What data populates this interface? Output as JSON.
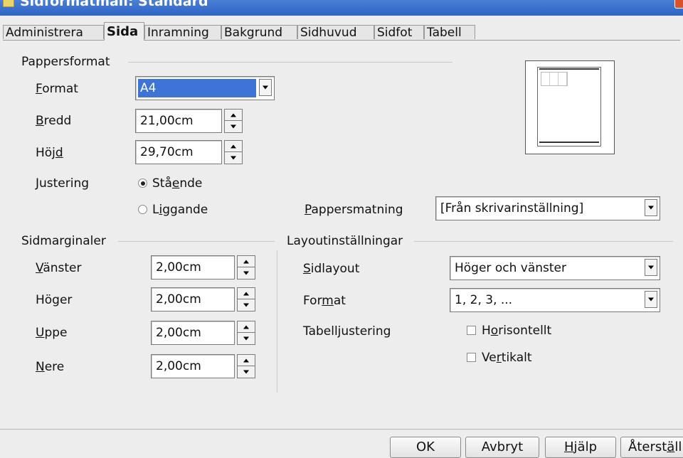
{
  "window": {
    "title": "Sidformatmall: Standard"
  },
  "tabs": [
    {
      "label": "Administrera"
    },
    {
      "label": "Sida"
    },
    {
      "label": "Inramning"
    },
    {
      "label": "Bakgrund"
    },
    {
      "label": "Sidhuvud"
    },
    {
      "label": "Sidfot"
    },
    {
      "label": "Tabell"
    }
  ],
  "paper_format": {
    "title": "Pappersformat",
    "format": {
      "key": "F",
      "rest": "ormat",
      "value": "A4"
    },
    "width": {
      "key": "B",
      "rest": "redd",
      "value": "21,00cm"
    },
    "height": {
      "pre": "Höj",
      "key": "d",
      "value": "29,70cm"
    },
    "orientation": {
      "label": "Justering",
      "portrait": {
        "pre": "Stå",
        "key": "e",
        "post": "nde",
        "checked": true
      },
      "landscape": {
        "pre": "L",
        "key": "i",
        "post": "ggande",
        "checked": false
      }
    },
    "paper_tray": {
      "key": "P",
      "rest": "appersmatning",
      "value": "[Från skrivarinställning]"
    }
  },
  "margins": {
    "title": "Sidmarginaler",
    "left": {
      "key": "V",
      "rest": "änster",
      "value": "2,00cm"
    },
    "right": {
      "label": "Höger",
      "value": "2,00cm"
    },
    "top": {
      "key": "U",
      "rest": "ppe",
      "value": "2,00cm"
    },
    "bottom": {
      "key": "N",
      "rest": "ere",
      "value": "2,00cm"
    }
  },
  "layout": {
    "title": "Layoutinställningar",
    "page_layout": {
      "key": "S",
      "rest": "idlayout",
      "value": "Höger och vänster"
    },
    "format": {
      "pre": "For",
      "key": "m",
      "post": "at",
      "value": "1, 2, 3, ..."
    },
    "table_alignment": {
      "label": "Tabelljustering",
      "horizontal": {
        "pre": "H",
        "key": "o",
        "post": "risontellt",
        "checked": false
      },
      "vertical": {
        "pre": "Ve",
        "key": "r",
        "post": "tikalt",
        "checked": false
      }
    }
  },
  "buttons": {
    "ok": "OK",
    "cancel": "Avbryt",
    "help": {
      "key": "H",
      "rest": "jälp"
    },
    "reset": {
      "pre": "Återst",
      "key": "ä",
      "post": "ll"
    }
  },
  "colors": {
    "titlebar": "#2f63c2",
    "dialog_bg": "#ededed",
    "selected_bg": "#3d74d6"
  }
}
